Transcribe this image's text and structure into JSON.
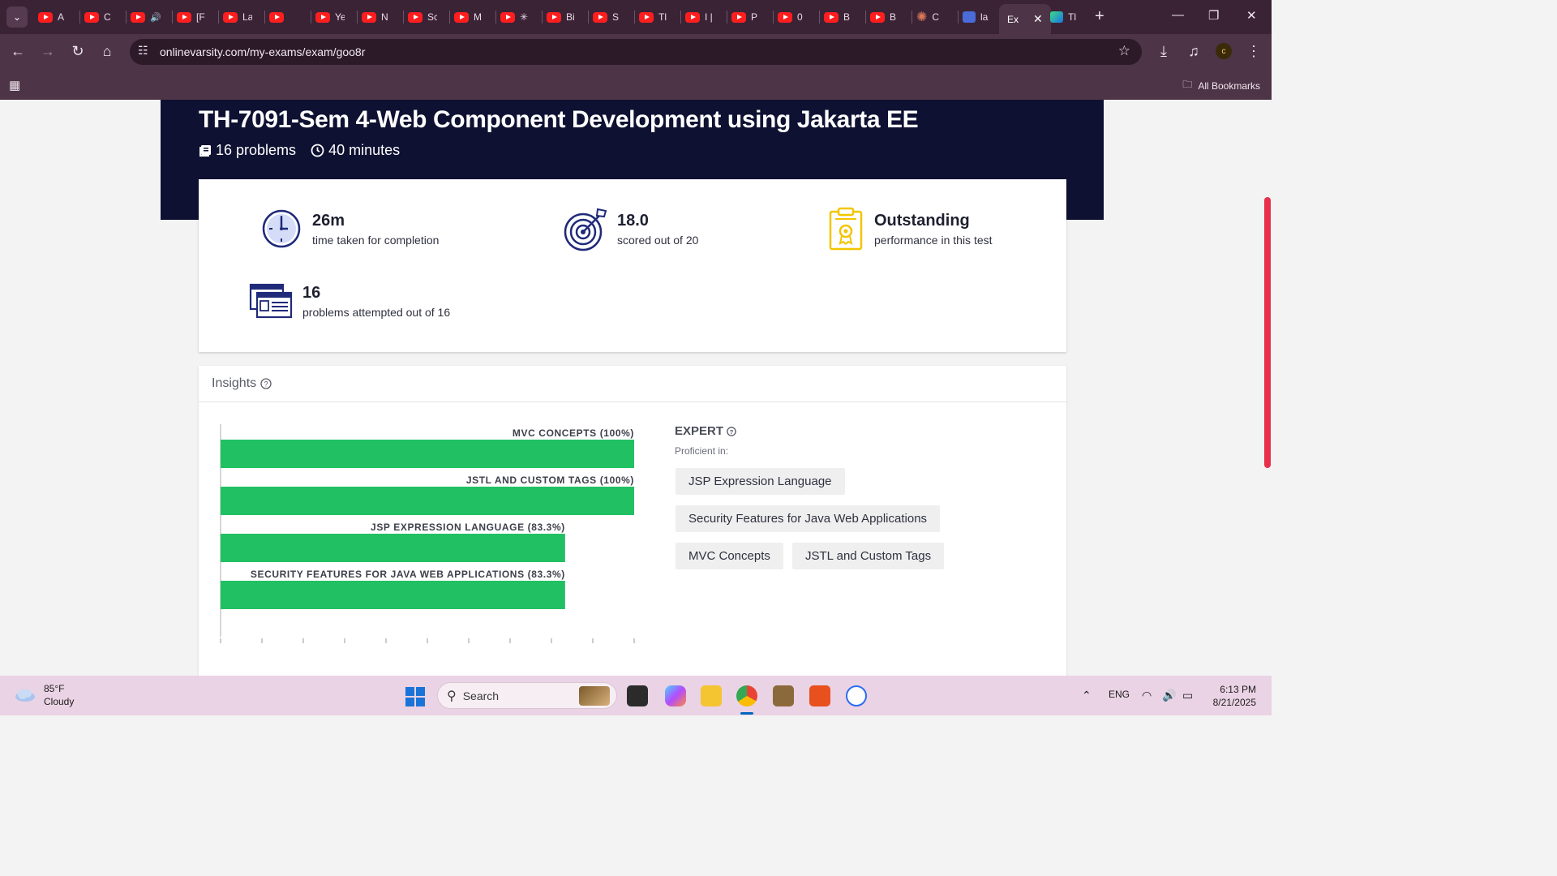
{
  "browser": {
    "tabs": [
      {
        "label": "A",
        "icon": "youtube-icon"
      },
      {
        "label": "C",
        "icon": "youtube-icon"
      },
      {
        "label": "",
        "icon": "youtube-icon",
        "audio": "🔊"
      },
      {
        "label": "[F",
        "icon": "youtube-icon"
      },
      {
        "label": "La",
        "icon": "youtube-icon"
      },
      {
        "label": "",
        "icon": "youtube-icon"
      },
      {
        "label": "Ye",
        "icon": "youtube-icon"
      },
      {
        "label": "N",
        "icon": "youtube-icon"
      },
      {
        "label": "Sc",
        "icon": "youtube-icon"
      },
      {
        "label": "M",
        "icon": "youtube-icon"
      },
      {
        "label": "✳",
        "icon": "youtube-icon"
      },
      {
        "label": "Bi",
        "icon": "youtube-icon"
      },
      {
        "label": "S",
        "icon": "youtube-icon"
      },
      {
        "label": "Tl",
        "icon": "youtube-icon"
      },
      {
        "label": "I |",
        "icon": "youtube-icon"
      },
      {
        "label": "P",
        "icon": "youtube-icon"
      },
      {
        "label": "0",
        "icon": "youtube-icon"
      },
      {
        "label": "B",
        "icon": "youtube-icon"
      },
      {
        "label": "B",
        "icon": "youtube-icon"
      },
      {
        "label": "C",
        "icon": "claude-icon"
      },
      {
        "label": "la",
        "icon": "app-icon"
      }
    ],
    "active_tab_label": "Ex",
    "last_tab_label": "Tl",
    "url": "onlinevarsity.com/my-exams/exam/goo8r",
    "profile_initial": "c",
    "all_bookmarks": "All Bookmarks"
  },
  "exam": {
    "title": "TH-7091-Sem 4-Web Component Development using Jakarta EE",
    "problems": "16 problems",
    "duration": "40 minutes"
  },
  "stats": {
    "time": {
      "value": "26m",
      "label": "time taken for completion"
    },
    "score": {
      "value": "18.0",
      "label": "scored out of 20"
    },
    "performance": {
      "value": "Outstanding",
      "label": "performance in this test"
    },
    "attempted": {
      "value": "16",
      "label": "problems attempted out of 16"
    }
  },
  "insights": {
    "title": "Insights",
    "level": "EXPERT",
    "proficient_label": "Proficient in:",
    "proficient_topics": [
      "JSP Expression Language",
      "Security Features for Java Web Applications",
      "MVC Concepts",
      "JSTL and Custom Tags"
    ]
  },
  "chart_data": {
    "type": "bar",
    "orientation": "horizontal",
    "categories": [
      "MVC CONCEPTS (100%)",
      "JSTL AND CUSTOM TAGS (100%)",
      "JSP EXPRESSION LANGUAGE (83.3%)",
      "SECURITY FEATURES FOR JAVA WEB APPLICATIONS (83.3%)"
    ],
    "values": [
      10,
      10,
      8.33,
      8.33
    ],
    "xlim": [
      0,
      10
    ],
    "xticks": [
      0,
      1,
      2,
      3,
      4,
      5,
      6,
      7,
      8,
      9,
      10
    ],
    "bar_color": "#21c063",
    "grid": false
  },
  "taskbar": {
    "weather_temp": "85°F",
    "weather_desc": "Cloudy",
    "search_placeholder": "Search",
    "language": "ENG",
    "time": "6:13 PM",
    "date": "8/21/2025"
  },
  "colors": {
    "hero_bg": "#0e1132",
    "accent_icon": "#2b2f8f",
    "badge_gold": "#f2c500"
  }
}
